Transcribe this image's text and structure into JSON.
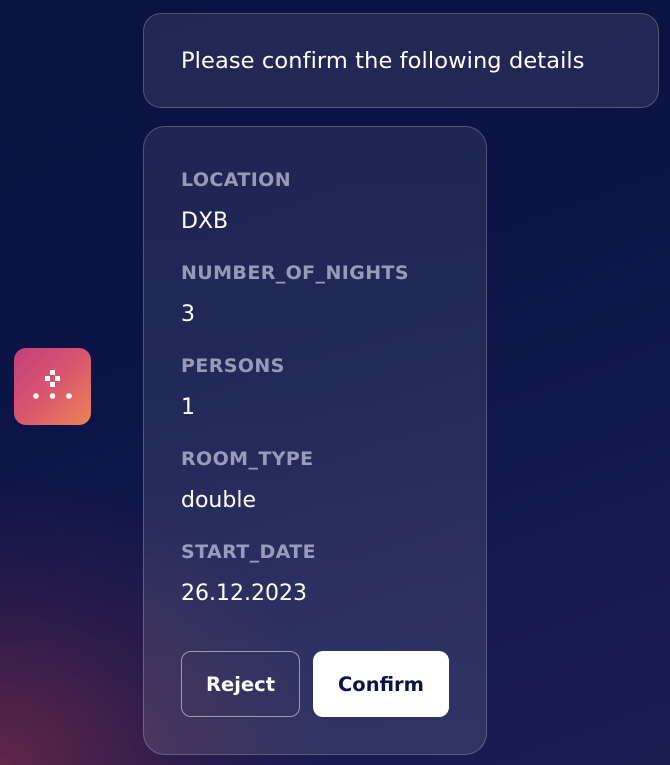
{
  "message": {
    "text": "Please confirm the following details"
  },
  "details": {
    "fields": [
      {
        "label": "LOCATION",
        "value": "DXB"
      },
      {
        "label": "NUMBER_OF_NIGHTS",
        "value": "3"
      },
      {
        "label": "PERSONS",
        "value": "1"
      },
      {
        "label": "ROOM_TYPE",
        "value": "double"
      },
      {
        "label": "START_DATE",
        "value": "26.12.2023"
      }
    ],
    "reject_label": "Reject",
    "confirm_label": "Confirm"
  },
  "avatar": {
    "icon": "dots-logo-icon",
    "gradient_start": "#c23f7a",
    "gradient_end": "#ea8456"
  },
  "colors": {
    "background": "#0c1448",
    "confirm_text": "#0b1445"
  }
}
